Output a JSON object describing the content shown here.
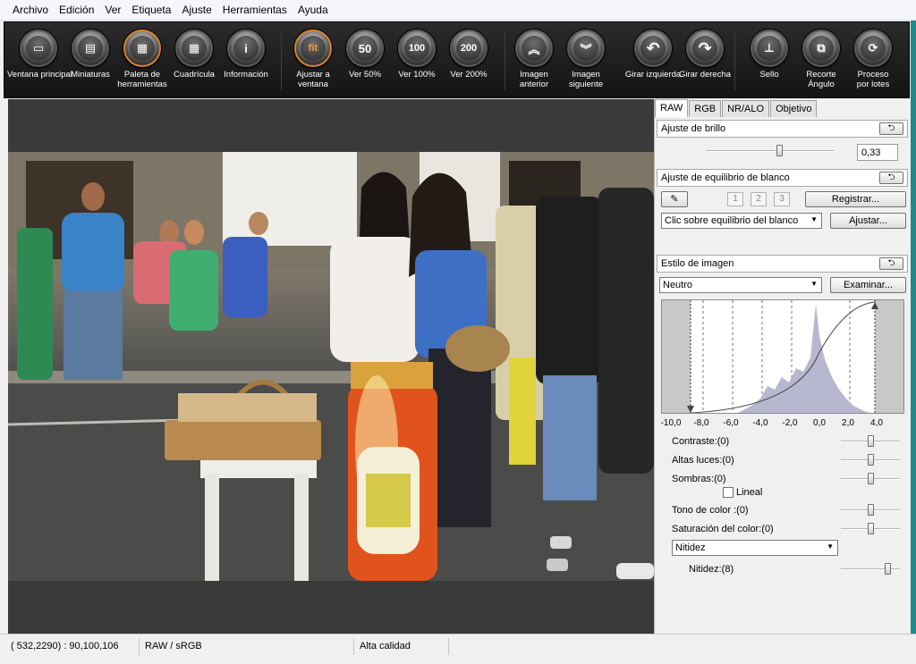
{
  "menu": [
    "Archivo",
    "Edición",
    "Ver",
    "Etiqueta",
    "Ajuste",
    "Herramientas",
    "Ayuda"
  ],
  "toolbar": [
    {
      "label": "Ventana principal",
      "icon": "window-icon",
      "glyph": "▭"
    },
    {
      "label": "Miniaturas",
      "icon": "thumbnails-icon",
      "glyph": "▤"
    },
    {
      "label": "Paleta de herramientas",
      "icon": "tool-palette-icon",
      "glyph": "▦",
      "active": true
    },
    {
      "label": "Cuadrícula",
      "icon": "grid-icon",
      "glyph": "▦"
    },
    {
      "label": "Información",
      "icon": "info-icon",
      "glyph": "i"
    },
    {
      "label": "Ajustar a ventana",
      "icon": "fit-icon",
      "glyph": "fit",
      "active": true
    },
    {
      "label": "Ver 50%",
      "icon": "zoom-50-icon",
      "glyph": "50"
    },
    {
      "label": "Ver 100%",
      "icon": "zoom-100-icon",
      "glyph": "100"
    },
    {
      "label": "Ver 200%",
      "icon": "zoom-200-icon",
      "glyph": "200"
    },
    {
      "label": "Imagen anterior",
      "icon": "previous-image-icon",
      "glyph": "︽"
    },
    {
      "label": "Imagen siguiente",
      "icon": "next-image-icon",
      "glyph": "︾"
    },
    {
      "label": "Girar izquierda",
      "icon": "rotate-left-icon",
      "glyph": "↶"
    },
    {
      "label": "Girar derecha",
      "icon": "rotate-right-icon",
      "glyph": "↷"
    },
    {
      "label": "Sello",
      "icon": "stamp-icon",
      "glyph": "⊥"
    },
    {
      "label": "Recorte Ángulo",
      "icon": "crop-angle-icon",
      "glyph": "⧉"
    },
    {
      "label": "Proceso por lotes",
      "icon": "batch-process-icon",
      "glyph": "⟳"
    }
  ],
  "tabs": [
    "RAW",
    "RGB",
    "NR/ALO",
    "Objetivo"
  ],
  "brightness": {
    "title": "Ajuste de brillo",
    "value": "0,33",
    "reset": "⮌"
  },
  "white_balance": {
    "title": "Ajuste de equilibrio de blanco",
    "slots": [
      "1",
      "2",
      "3"
    ],
    "register": "Registrar...",
    "mode": "Clic sobre equilibrio del blanco",
    "adjust": "Ajustar...",
    "reset": "⮌"
  },
  "picture_style": {
    "title": "Estilo de imagen",
    "style": "Neutro",
    "browse": "Examinar...",
    "reset": "⮌"
  },
  "histogram_ticks": [
    "-10,0",
    "-8,0",
    "-6,0",
    "-4,0",
    "-2,0",
    "0,0",
    "2,0",
    "4,0"
  ],
  "params": {
    "contrast": {
      "label": "Contraste:(0)",
      "level": 0.5
    },
    "highlights": {
      "label": "Altas luces:(0)",
      "level": 0.5
    },
    "shadows": {
      "label": "Sombras:(0)",
      "level": 0.5
    },
    "linear": "Lineal",
    "color_tone": {
      "label": "Tono de color :(0)",
      "level": 0.5
    },
    "saturation": {
      "label": "Saturación del color:(0)",
      "level": 0.5
    },
    "sharpness_mode": "Nitidez",
    "sharpness": {
      "label": "Nitidez:(8)",
      "level": 0.8
    }
  },
  "status": {
    "coords": "( 532,2290) :  90,100,106",
    "format": "RAW / sRGB",
    "quality": "Alta calidad"
  },
  "colors": {
    "accent": "#d9822b",
    "toolbar": "#1c1c1c",
    "viewer": "#3a3a3a",
    "edge": "#1f8a8a"
  }
}
